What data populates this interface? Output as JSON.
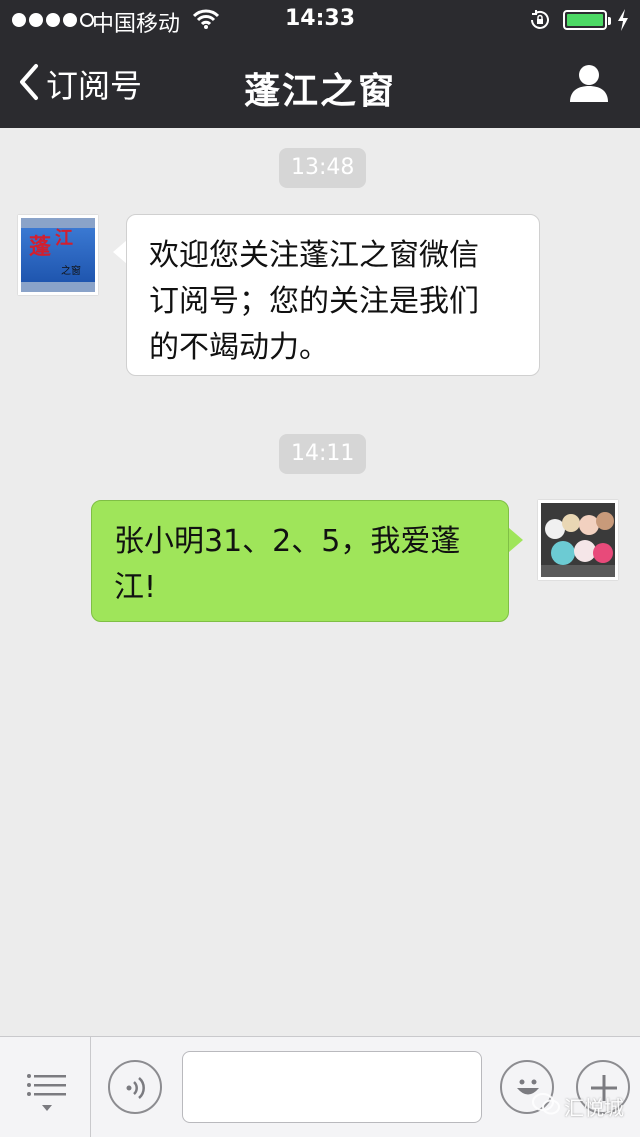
{
  "status_bar": {
    "carrier": "中国移动",
    "time": "14:33"
  },
  "nav": {
    "back_label": "订阅号",
    "title": "蓬江之窗"
  },
  "messages": [
    {
      "timestamp": "13:48"
    },
    {
      "direction": "in",
      "text_lines": [
        "欢迎您关注蓬江之窗微信",
        "订阅号；您的关注是我们",
        "的不竭动力。"
      ],
      "avatar_text": "蓬江之窗"
    },
    {
      "timestamp": "14:11"
    },
    {
      "direction": "out",
      "text_lines": [
        "张小明31、2、5，我爱蓬",
        "江!"
      ]
    }
  ],
  "input_bar": {
    "placeholder": ""
  },
  "watermark": "汇悦城",
  "colors": {
    "header_bg": "#2b2b2f",
    "chat_bg": "#ececec",
    "out_bubble": "#9fe55a",
    "battery": "#4cd964"
  },
  "icons": [
    "wifi-icon",
    "rotation-lock-icon",
    "battery-icon",
    "charging-bolt-icon",
    "back-chevron-icon",
    "profile-icon",
    "menu-list-icon",
    "voice-icon",
    "emoji-icon",
    "plus-icon"
  ]
}
